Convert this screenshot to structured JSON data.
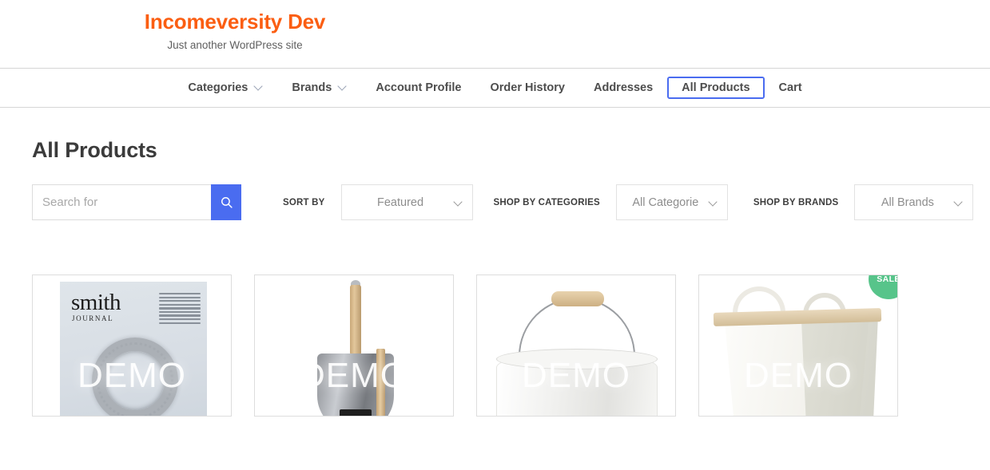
{
  "site": {
    "title": "Incomeversity Dev",
    "tagline": "Just another WordPress site"
  },
  "nav": {
    "items": [
      {
        "label": "Categories",
        "has_chevron": true,
        "focused": false,
        "icon": "chevron-down-icon"
      },
      {
        "label": "Brands",
        "has_chevron": true,
        "focused": false,
        "icon": "chevron-down-icon"
      },
      {
        "label": "Account Profile",
        "has_chevron": false,
        "focused": false,
        "icon": ""
      },
      {
        "label": "Order History",
        "has_chevron": false,
        "focused": false,
        "icon": ""
      },
      {
        "label": "Addresses",
        "has_chevron": false,
        "focused": false,
        "icon": ""
      },
      {
        "label": "All Products",
        "has_chevron": false,
        "focused": true,
        "icon": ""
      },
      {
        "label": "Cart",
        "has_chevron": false,
        "focused": false,
        "icon": ""
      }
    ]
  },
  "page": {
    "title": "All Products"
  },
  "toolbar": {
    "search": {
      "value": "",
      "placeholder": "Search for",
      "button_icon": "search-icon"
    },
    "sort": {
      "label": "SORT BY",
      "selected": "Featured"
    },
    "categories": {
      "label": "SHOP BY CATEGORIES",
      "selected": "All Categorie"
    },
    "brands": {
      "label": "SHOP BY BRANDS",
      "selected": "All Brands"
    }
  },
  "products": {
    "watermark": "DEMO",
    "sale_badge_label": "SALE",
    "items": [
      {
        "name": "smith-journal-magazine",
        "watermark": "DEMO",
        "on_sale": false,
        "cover_title": "smith",
        "cover_subtitle": "JOURNAL"
      },
      {
        "name": "garden-shovel",
        "watermark": "DEMO",
        "on_sale": false
      },
      {
        "name": "metal-bucket",
        "watermark": "DEMO",
        "on_sale": false
      },
      {
        "name": "canvas-tote-bag",
        "watermark": "DEMO",
        "on_sale": true
      }
    ]
  },
  "colors": {
    "brand_orange": "#fb5e12",
    "accent_blue": "#4a6cf0",
    "sale_green": "#57c48a",
    "text_dark": "#3b3b3b",
    "border_gray": "#d6d6d6"
  }
}
